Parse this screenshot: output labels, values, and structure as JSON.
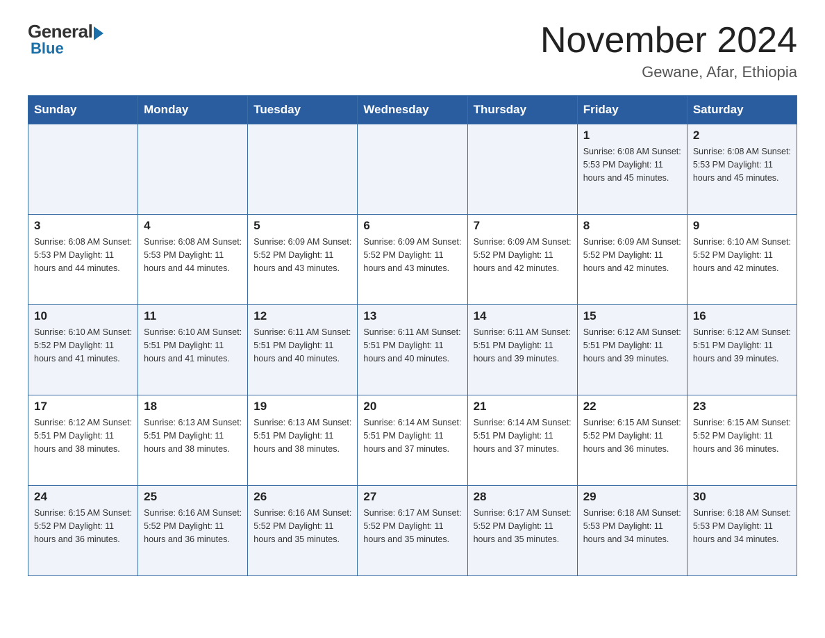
{
  "header": {
    "logo_general": "General",
    "logo_blue": "Blue",
    "month_title": "November 2024",
    "location": "Gewane, Afar, Ethiopia"
  },
  "days_of_week": [
    "Sunday",
    "Monday",
    "Tuesday",
    "Wednesday",
    "Thursday",
    "Friday",
    "Saturday"
  ],
  "weeks": [
    [
      {
        "day": "",
        "info": ""
      },
      {
        "day": "",
        "info": ""
      },
      {
        "day": "",
        "info": ""
      },
      {
        "day": "",
        "info": ""
      },
      {
        "day": "",
        "info": ""
      },
      {
        "day": "1",
        "info": "Sunrise: 6:08 AM\nSunset: 5:53 PM\nDaylight: 11 hours and 45 minutes."
      },
      {
        "day": "2",
        "info": "Sunrise: 6:08 AM\nSunset: 5:53 PM\nDaylight: 11 hours and 45 minutes."
      }
    ],
    [
      {
        "day": "3",
        "info": "Sunrise: 6:08 AM\nSunset: 5:53 PM\nDaylight: 11 hours and 44 minutes."
      },
      {
        "day": "4",
        "info": "Sunrise: 6:08 AM\nSunset: 5:53 PM\nDaylight: 11 hours and 44 minutes."
      },
      {
        "day": "5",
        "info": "Sunrise: 6:09 AM\nSunset: 5:52 PM\nDaylight: 11 hours and 43 minutes."
      },
      {
        "day": "6",
        "info": "Sunrise: 6:09 AM\nSunset: 5:52 PM\nDaylight: 11 hours and 43 minutes."
      },
      {
        "day": "7",
        "info": "Sunrise: 6:09 AM\nSunset: 5:52 PM\nDaylight: 11 hours and 42 minutes."
      },
      {
        "day": "8",
        "info": "Sunrise: 6:09 AM\nSunset: 5:52 PM\nDaylight: 11 hours and 42 minutes."
      },
      {
        "day": "9",
        "info": "Sunrise: 6:10 AM\nSunset: 5:52 PM\nDaylight: 11 hours and 42 minutes."
      }
    ],
    [
      {
        "day": "10",
        "info": "Sunrise: 6:10 AM\nSunset: 5:52 PM\nDaylight: 11 hours and 41 minutes."
      },
      {
        "day": "11",
        "info": "Sunrise: 6:10 AM\nSunset: 5:51 PM\nDaylight: 11 hours and 41 minutes."
      },
      {
        "day": "12",
        "info": "Sunrise: 6:11 AM\nSunset: 5:51 PM\nDaylight: 11 hours and 40 minutes."
      },
      {
        "day": "13",
        "info": "Sunrise: 6:11 AM\nSunset: 5:51 PM\nDaylight: 11 hours and 40 minutes."
      },
      {
        "day": "14",
        "info": "Sunrise: 6:11 AM\nSunset: 5:51 PM\nDaylight: 11 hours and 39 minutes."
      },
      {
        "day": "15",
        "info": "Sunrise: 6:12 AM\nSunset: 5:51 PM\nDaylight: 11 hours and 39 minutes."
      },
      {
        "day": "16",
        "info": "Sunrise: 6:12 AM\nSunset: 5:51 PM\nDaylight: 11 hours and 39 minutes."
      }
    ],
    [
      {
        "day": "17",
        "info": "Sunrise: 6:12 AM\nSunset: 5:51 PM\nDaylight: 11 hours and 38 minutes."
      },
      {
        "day": "18",
        "info": "Sunrise: 6:13 AM\nSunset: 5:51 PM\nDaylight: 11 hours and 38 minutes."
      },
      {
        "day": "19",
        "info": "Sunrise: 6:13 AM\nSunset: 5:51 PM\nDaylight: 11 hours and 38 minutes."
      },
      {
        "day": "20",
        "info": "Sunrise: 6:14 AM\nSunset: 5:51 PM\nDaylight: 11 hours and 37 minutes."
      },
      {
        "day": "21",
        "info": "Sunrise: 6:14 AM\nSunset: 5:51 PM\nDaylight: 11 hours and 37 minutes."
      },
      {
        "day": "22",
        "info": "Sunrise: 6:15 AM\nSunset: 5:52 PM\nDaylight: 11 hours and 36 minutes."
      },
      {
        "day": "23",
        "info": "Sunrise: 6:15 AM\nSunset: 5:52 PM\nDaylight: 11 hours and 36 minutes."
      }
    ],
    [
      {
        "day": "24",
        "info": "Sunrise: 6:15 AM\nSunset: 5:52 PM\nDaylight: 11 hours and 36 minutes."
      },
      {
        "day": "25",
        "info": "Sunrise: 6:16 AM\nSunset: 5:52 PM\nDaylight: 11 hours and 36 minutes."
      },
      {
        "day": "26",
        "info": "Sunrise: 6:16 AM\nSunset: 5:52 PM\nDaylight: 11 hours and 35 minutes."
      },
      {
        "day": "27",
        "info": "Sunrise: 6:17 AM\nSunset: 5:52 PM\nDaylight: 11 hours and 35 minutes."
      },
      {
        "day": "28",
        "info": "Sunrise: 6:17 AM\nSunset: 5:52 PM\nDaylight: 11 hours and 35 minutes."
      },
      {
        "day": "29",
        "info": "Sunrise: 6:18 AM\nSunset: 5:53 PM\nDaylight: 11 hours and 34 minutes."
      },
      {
        "day": "30",
        "info": "Sunrise: 6:18 AM\nSunset: 5:53 PM\nDaylight: 11 hours and 34 minutes."
      }
    ]
  ]
}
